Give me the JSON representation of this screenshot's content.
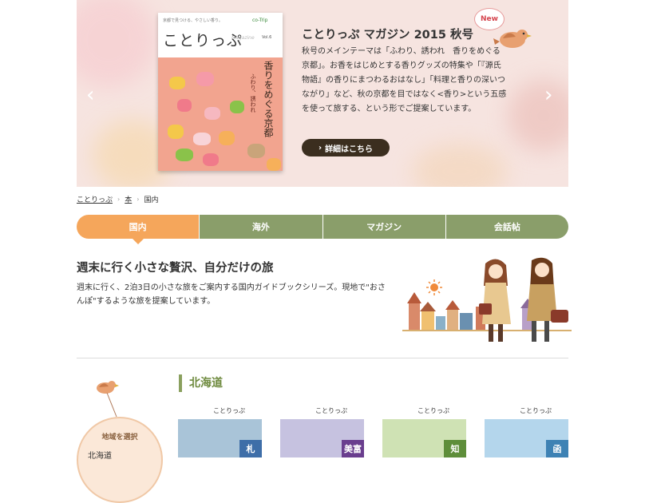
{
  "hero": {
    "title": "ことりっぷ マガジン 2015 秋号",
    "text": "秋号のメインテーマは「ふわり、誘われ　香りをめぐる京都」。お香をはじめとする香りグッズの特集や「『源氏物語』の香りにまつわるおはなし」「料理と香りの深いつながり」など、秋の京都を目ではなく<香り>という五感を使って旅する、という形でご提案しています。",
    "button_label": "詳細はこちら",
    "button_icon": "›",
    "new_badge": "New",
    "prev_arrow": "‹",
    "next_arrow": "›",
    "cover": {
      "tagline": "京都で見つける、やさしい香り。",
      "title": "ことりっぷ",
      "magazine": "Magazine",
      "logo": "co-Trip",
      "vol": "Vol.6",
      "headline": "香りをめぐる京都",
      "sub": "ふわり、誘われ"
    }
  },
  "breadcrumb": {
    "items": [
      "ことりっぷ",
      "本",
      "国内"
    ],
    "separator": "›"
  },
  "tabs": [
    {
      "label": "国内",
      "active": true
    },
    {
      "label": "海外",
      "active": false
    },
    {
      "label": "マガジン",
      "active": false
    },
    {
      "label": "会話帖",
      "active": false
    }
  ],
  "intro": {
    "title": "週末に行く小さな贅沢、自分だけの旅",
    "text": "週末に行く、2泊3日の小さな旅をご案内する国内ガイドブックシリーズ。現地で\"おさんぽ\"するような旅を提案しています。"
  },
  "region_select": {
    "label": "地域を選択",
    "first_item": "北海道"
  },
  "section": {
    "title": "北海道"
  },
  "books": [
    {
      "title": "ことりっぷ",
      "spine": "札",
      "color": "#3e6ea8",
      "top": "#a9c4d8"
    },
    {
      "title": "ことりっぷ",
      "spine": "美富",
      "color": "#6a3e8e",
      "top": "#c6c2e0"
    },
    {
      "title": "ことりっぷ",
      "spine": "知",
      "color": "#5e8e3a",
      "top": "#cfe2b4"
    },
    {
      "title": "ことりっぷ",
      "spine": "函",
      "color": "#3e82b4",
      "top": "#b4d6ec"
    }
  ],
  "colors": {
    "accent_orange": "#f5a65b",
    "tab_green": "#8a9e6a",
    "section_green": "#6e8a3e",
    "button_dark": "#3b2e1f",
    "new_red": "#d5454e"
  }
}
